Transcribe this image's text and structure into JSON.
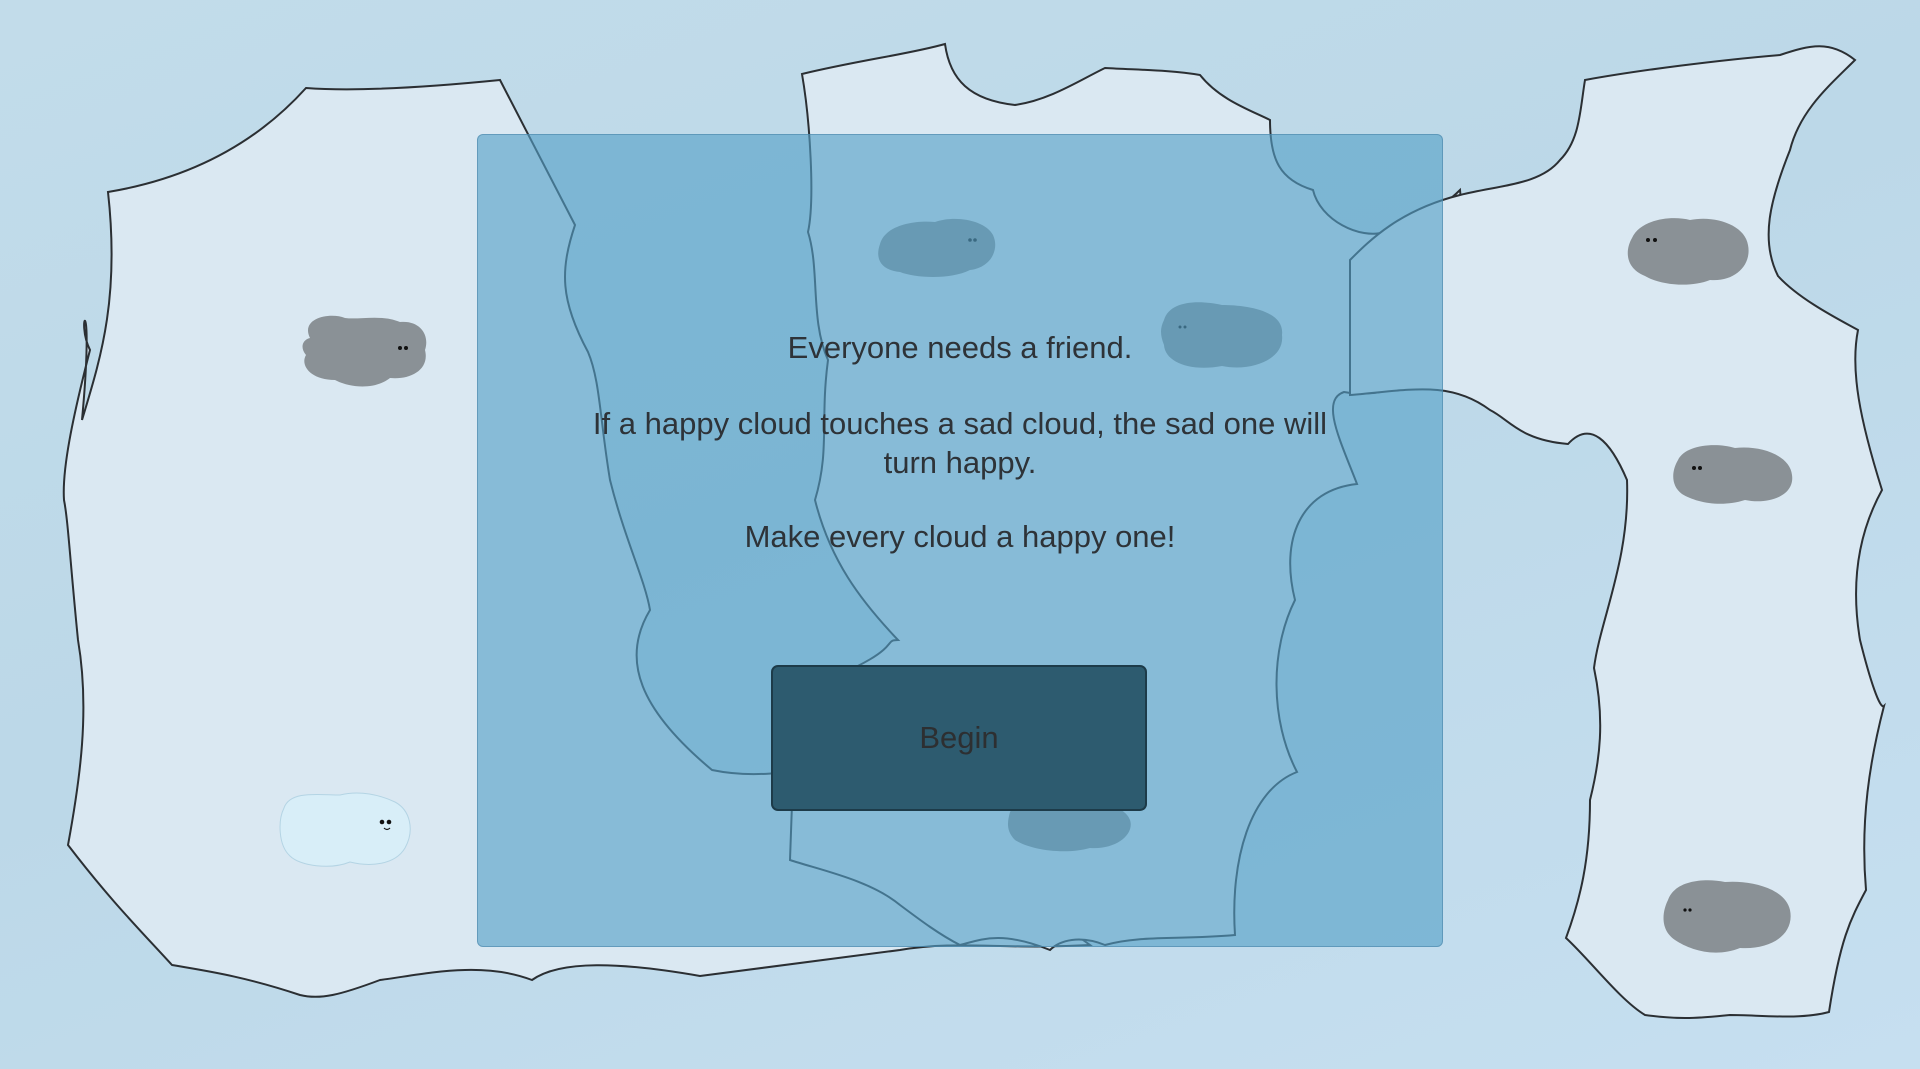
{
  "intro": {
    "line1": "Everyone needs a friend.",
    "line2": "If a happy cloud touches a sad cloud, the sad one will turn happy.",
    "line3": "Make every cloud a happy one!"
  },
  "begin_button": {
    "label": "Begin"
  },
  "colors": {
    "sky": "#c2dcea",
    "island": "#dae8f2",
    "overlay": "#54a0c7",
    "button": "#2d5b6f",
    "sad_cloud": "#8a9196",
    "happy_cloud": "#d8eef8"
  },
  "clouds": [
    {
      "mood": "sad"
    },
    {
      "mood": "happy"
    },
    {
      "mood": "sad"
    },
    {
      "mood": "sad"
    },
    {
      "mood": "sad"
    },
    {
      "mood": "sad"
    },
    {
      "mood": "sad"
    },
    {
      "mood": "sad"
    }
  ]
}
